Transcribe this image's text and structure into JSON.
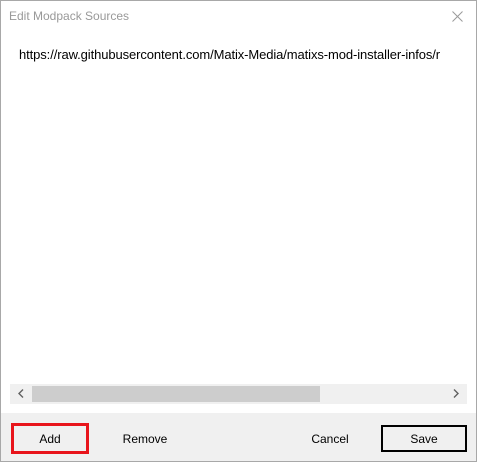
{
  "window": {
    "title": "Edit Modpack Sources"
  },
  "sources": {
    "items": [
      "https://raw.githubusercontent.com/Matix-Media/matixs-mod-installer-infos/r"
    ]
  },
  "buttons": {
    "add": "Add",
    "remove": "Remove",
    "cancel": "Cancel",
    "save": "Save"
  },
  "icons": {
    "close": "close-icon",
    "scroll_left": "chevron-left-icon",
    "scroll_right": "chevron-right-icon"
  },
  "colors": {
    "highlight": "#e8151b",
    "title_text": "#999999",
    "footer_bg": "#f0f0f0",
    "scroll_thumb": "#cdcdcd"
  }
}
